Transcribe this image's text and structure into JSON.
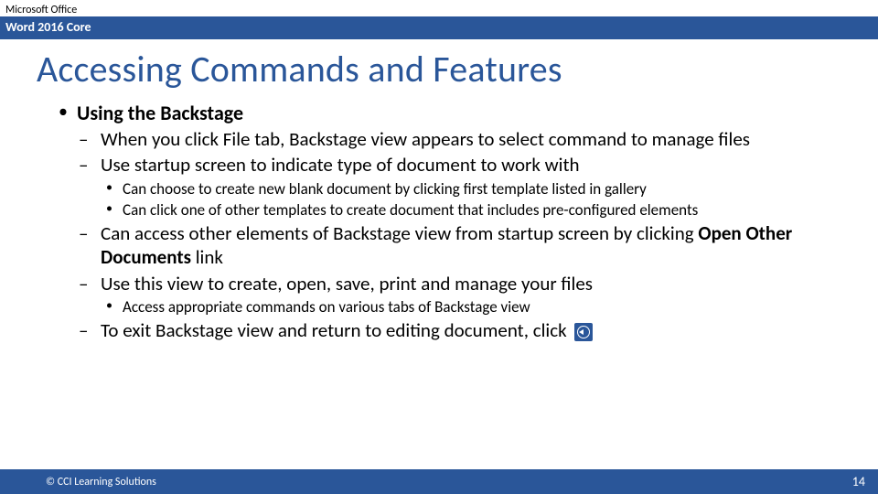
{
  "header": {
    "suite": "Microsoft Office",
    "product": "Word 2016 Core"
  },
  "title": "Accessing Commands and Features",
  "content": {
    "heading": "Using the Backstage",
    "sub1": "When you click File tab, Backstage view appears to select command to manage files",
    "sub2": "Use startup screen to indicate type of document to work with",
    "sub2a": "Can choose to create new blank document by clicking first template listed in gallery",
    "sub2b": "Can click one of other templates to create document that includes pre-configured elements",
    "sub3_pre": "Can access other elements of Backstage view from startup screen by clicking ",
    "sub3_bold": "Open Other Documents",
    "sub3_post": " link",
    "sub4": "Use this view to create, open, save, print and manage your files",
    "sub4a": "Access appropriate commands on various tabs of Backstage view",
    "sub5": "To exit Backstage view and return to editing document, click "
  },
  "footer": {
    "copyright": "© CCI Learning Solutions",
    "page": "14"
  }
}
